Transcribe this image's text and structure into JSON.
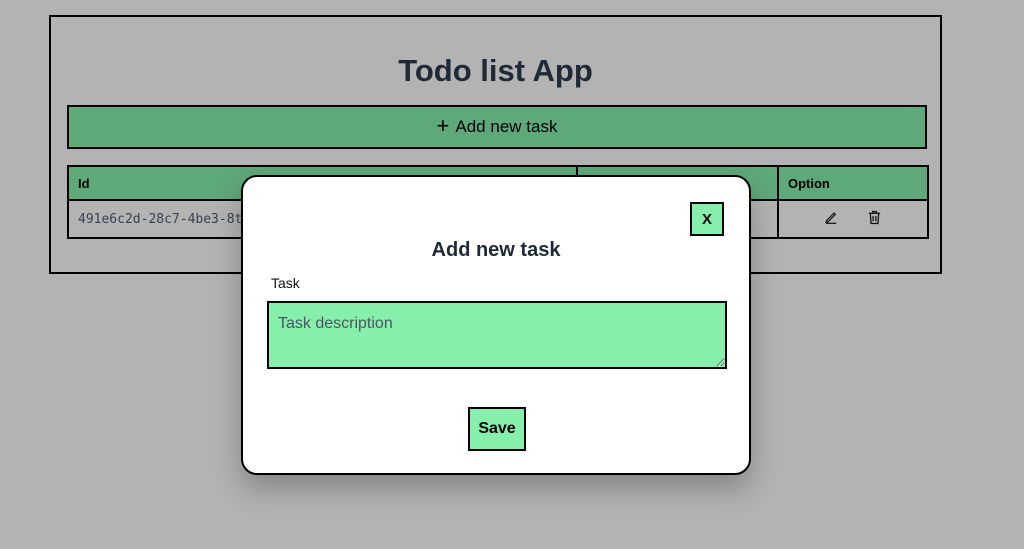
{
  "app": {
    "title": "Todo list App",
    "add_task_label": "Add new task"
  },
  "table": {
    "headers": {
      "id": "Id",
      "task": "",
      "option": "Option"
    },
    "rows": [
      {
        "id": "491e6c2d-28c7-4be3-8t",
        "task": ""
      }
    ],
    "option_icons": [
      "pencil-edit-icon",
      "trash-delete-icon"
    ]
  },
  "modal": {
    "close_label": "X",
    "title": "Add new task",
    "task_label": "Task",
    "task_placeholder": "Task description",
    "save_label": "Save"
  },
  "colors": {
    "background_overlay": "#b3b3b3",
    "table_green": "#5fa87a",
    "light_green": "#86efac"
  }
}
